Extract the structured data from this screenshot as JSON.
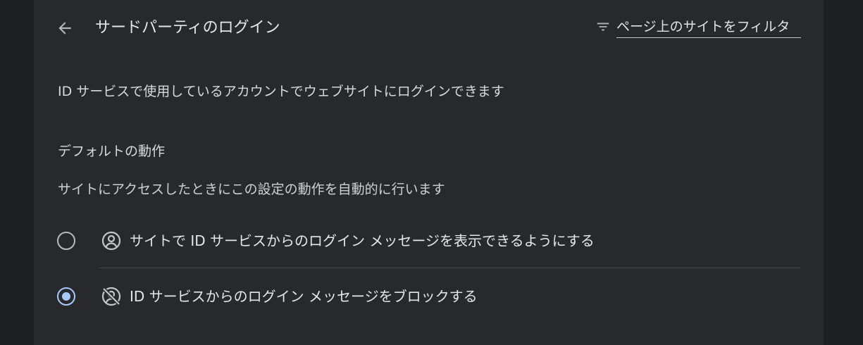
{
  "header": {
    "title": "サードパーティのログイン",
    "back_icon": "arrow-back-icon",
    "filter": {
      "icon": "filter-list-icon",
      "placeholder": "ページ上のサイトをフィルタ",
      "value": ""
    }
  },
  "main": {
    "description": "ID サービスで使用しているアカウントでウェブサイトにログインできます",
    "default_behavior": {
      "title": "デフォルトの動作",
      "subtitle": "サイトにアクセスしたときにこの設定の動作を自動的に行います",
      "options": [
        {
          "label": "サイトで ID サービスからのログイン メッセージを表示できるようにする",
          "icon": "account-circle-icon",
          "selected": false
        },
        {
          "label": "ID サービスからのログイン メッセージをブロックする",
          "icon": "account-circle-off-icon",
          "selected": true
        }
      ]
    }
  },
  "colors": {
    "background": "#1e1f22",
    "card": "#28292c",
    "accent": "#a8c7fa",
    "text": "#e3e3e3"
  }
}
